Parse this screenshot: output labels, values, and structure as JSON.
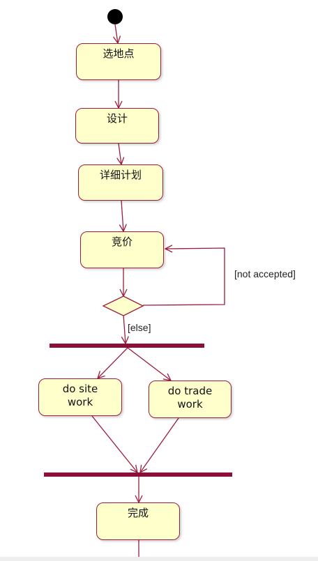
{
  "diagram": {
    "activities": {
      "select_site": "选地点",
      "design": "设计",
      "detailed_plan": "详细计划",
      "bidding": "竞价",
      "site_work": "do site\nwork",
      "trade_work": "do  trade\nwork",
      "complete": "完成"
    },
    "guards": {
      "not_accepted": "[not accepted]",
      "else": "[else]"
    },
    "colors": {
      "line": "#9c1c3c",
      "bar": "#8c0f3a",
      "fill": "#ffffcc",
      "initial": "#000000"
    }
  }
}
